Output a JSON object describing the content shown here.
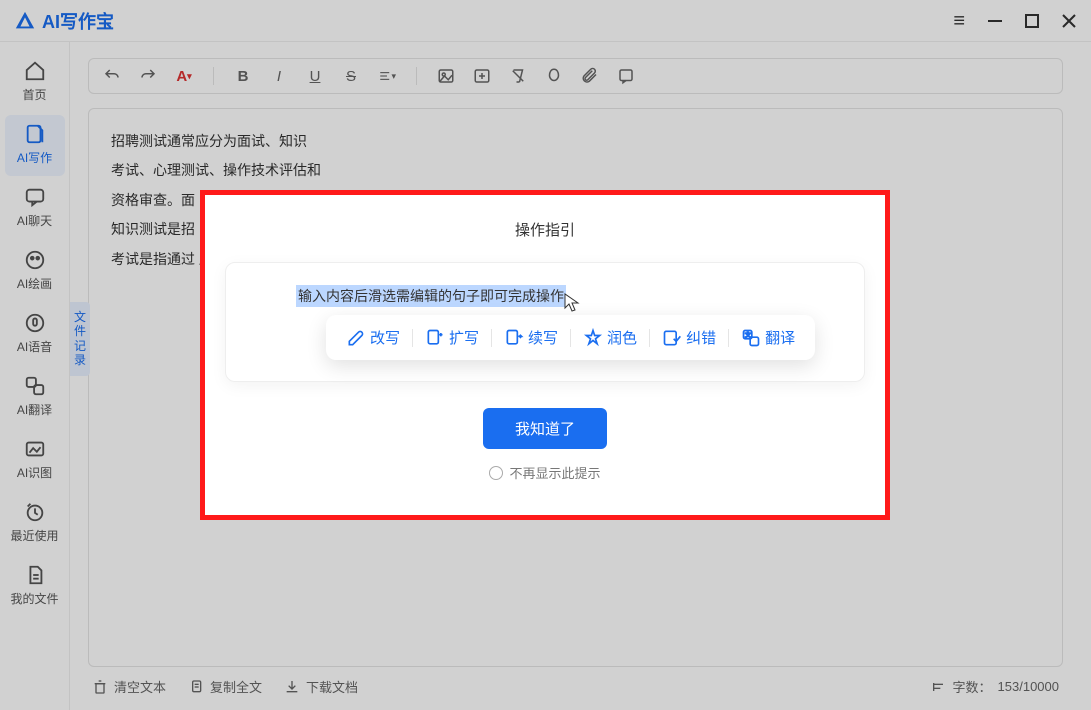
{
  "app": {
    "name": "AI写作宝"
  },
  "sidebar": {
    "items": [
      {
        "label": "首页"
      },
      {
        "label": "AI写作"
      },
      {
        "label": "AI聊天"
      },
      {
        "label": "AI绘画"
      },
      {
        "label": "AI语音"
      },
      {
        "label": "AI翻译"
      },
      {
        "label": "AI识图"
      },
      {
        "label": "最近使用"
      },
      {
        "label": "我的文件"
      }
    ],
    "file_tab": "文件记录"
  },
  "editor": {
    "lines": [
      "招聘测试通常应分为面试、知识",
      "考试、心理测试、操作技术评估和",
      "资格审查。面",
      "知识测试是招",
      "考试是指通过                                                                                                                                                               度 候选人的知识、专业知识候选"
    ]
  },
  "footer": {
    "clear": "清空文本",
    "copy": "复制全文",
    "download": "下载文档",
    "count_label": "字数：",
    "count_value": "153/10000"
  },
  "modal": {
    "title": "操作指引",
    "selected_text": "输入内容后滑选需编辑的句子即可完成操作",
    "actions": [
      {
        "label": "改写"
      },
      {
        "label": "扩写"
      },
      {
        "label": "续写"
      },
      {
        "label": "润色"
      },
      {
        "label": "纠错"
      },
      {
        "label": "翻译"
      }
    ],
    "ok": "我知道了",
    "dont_show": "不再显示此提示"
  }
}
